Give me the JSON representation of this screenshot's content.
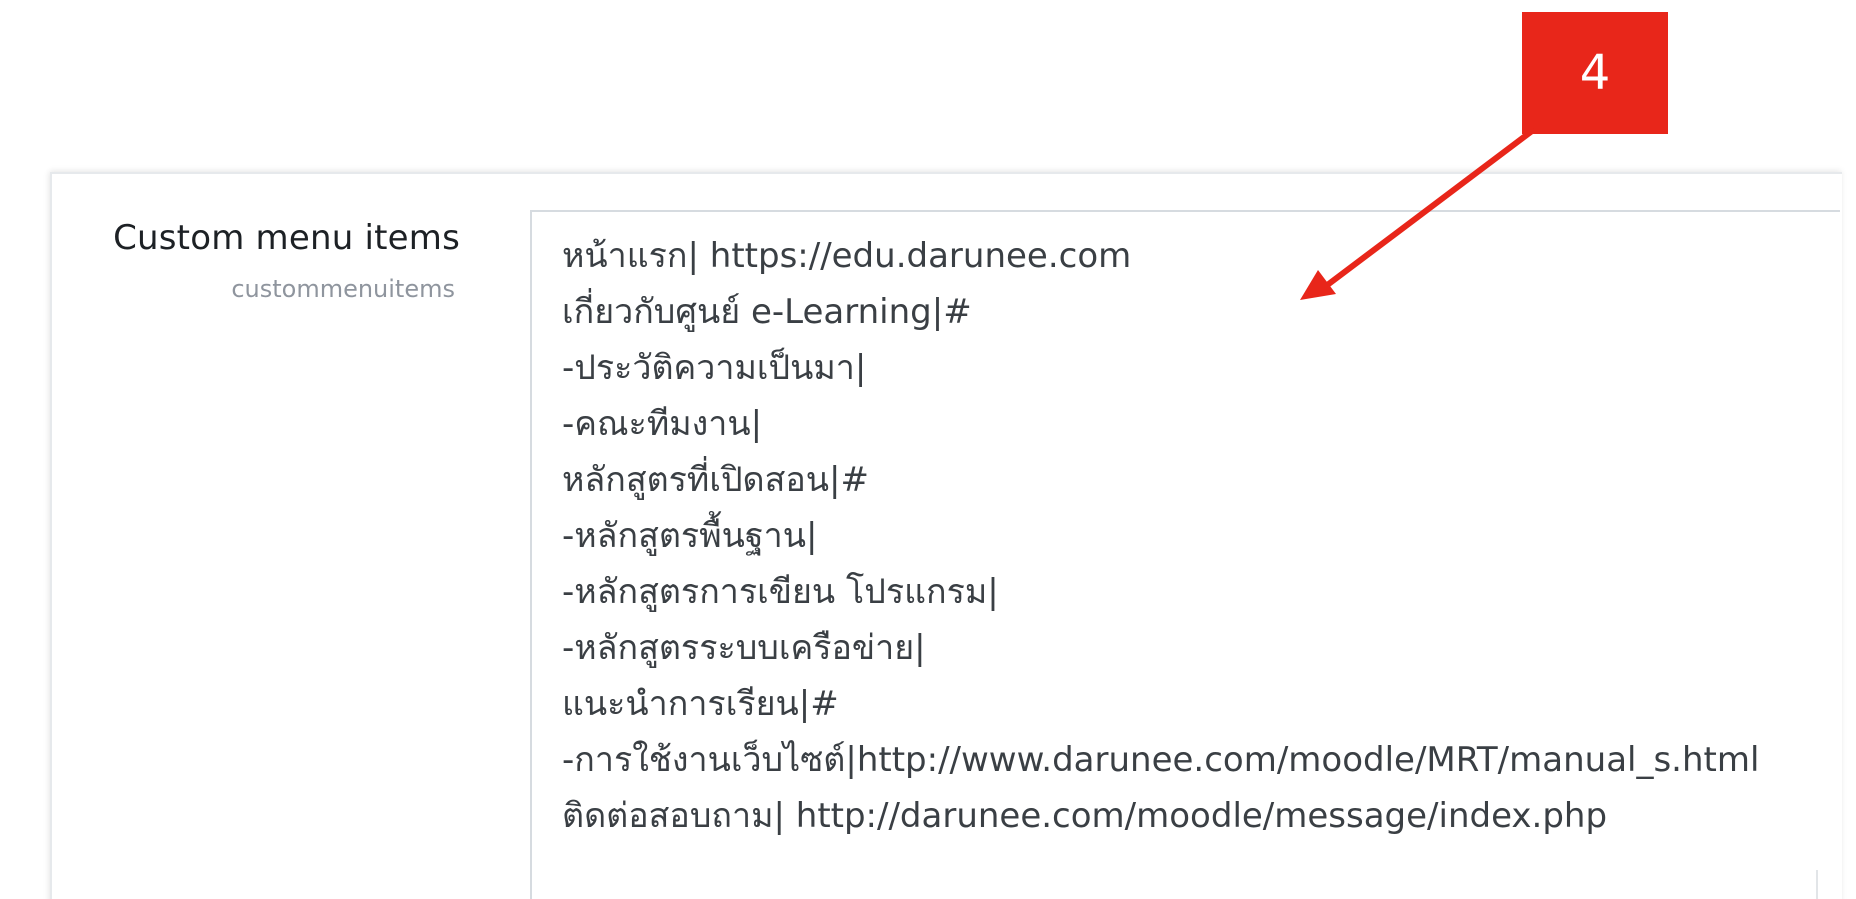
{
  "setting": {
    "title": "Custom menu items",
    "key": "custommenuitems"
  },
  "textarea": {
    "lines": [
      "หน้าแรก| https://edu.darunee.com",
      "เกี่ยวกับศูนย์ e-Learning|#",
      "-ประวัติความเป็นมา|",
      "-คณะทีมงาน|",
      "หลักสูตรที่เปิดสอน|#",
      "-หลักสูตรพื้นฐาน|",
      "-หลักสูตรการเขียน โปรแกรม|",
      "-หลักสูตรระบบเครือข่าย|",
      "แนะนำการเรียน|#",
      "-การใช้งานเว็บไซต์|http://www.darunee.com/moodle/MRT/manual_s.html",
      "ติดต่อสอบถาม| http://darunee.com/moodle/message/index.php"
    ]
  },
  "annotation": {
    "step_number": "4",
    "color": "#e8261a"
  }
}
